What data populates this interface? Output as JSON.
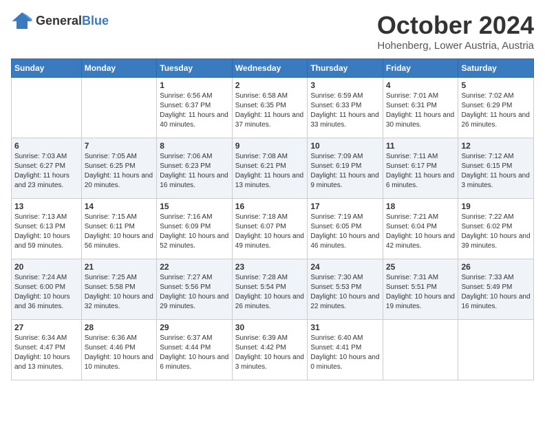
{
  "header": {
    "logo_general": "General",
    "logo_blue": "Blue",
    "month": "October 2024",
    "location": "Hohenberg, Lower Austria, Austria"
  },
  "days_of_week": [
    "Sunday",
    "Monday",
    "Tuesday",
    "Wednesday",
    "Thursday",
    "Friday",
    "Saturday"
  ],
  "weeks": [
    [
      {
        "day": "",
        "info": ""
      },
      {
        "day": "",
        "info": ""
      },
      {
        "day": "1",
        "info": "Sunrise: 6:56 AM\nSunset: 6:37 PM\nDaylight: 11 hours and 40 minutes."
      },
      {
        "day": "2",
        "info": "Sunrise: 6:58 AM\nSunset: 6:35 PM\nDaylight: 11 hours and 37 minutes."
      },
      {
        "day": "3",
        "info": "Sunrise: 6:59 AM\nSunset: 6:33 PM\nDaylight: 11 hours and 33 minutes."
      },
      {
        "day": "4",
        "info": "Sunrise: 7:01 AM\nSunset: 6:31 PM\nDaylight: 11 hours and 30 minutes."
      },
      {
        "day": "5",
        "info": "Sunrise: 7:02 AM\nSunset: 6:29 PM\nDaylight: 11 hours and 26 minutes."
      }
    ],
    [
      {
        "day": "6",
        "info": "Sunrise: 7:03 AM\nSunset: 6:27 PM\nDaylight: 11 hours and 23 minutes."
      },
      {
        "day": "7",
        "info": "Sunrise: 7:05 AM\nSunset: 6:25 PM\nDaylight: 11 hours and 20 minutes."
      },
      {
        "day": "8",
        "info": "Sunrise: 7:06 AM\nSunset: 6:23 PM\nDaylight: 11 hours and 16 minutes."
      },
      {
        "day": "9",
        "info": "Sunrise: 7:08 AM\nSunset: 6:21 PM\nDaylight: 11 hours and 13 minutes."
      },
      {
        "day": "10",
        "info": "Sunrise: 7:09 AM\nSunset: 6:19 PM\nDaylight: 11 hours and 9 minutes."
      },
      {
        "day": "11",
        "info": "Sunrise: 7:11 AM\nSunset: 6:17 PM\nDaylight: 11 hours and 6 minutes."
      },
      {
        "day": "12",
        "info": "Sunrise: 7:12 AM\nSunset: 6:15 PM\nDaylight: 11 hours and 3 minutes."
      }
    ],
    [
      {
        "day": "13",
        "info": "Sunrise: 7:13 AM\nSunset: 6:13 PM\nDaylight: 10 hours and 59 minutes."
      },
      {
        "day": "14",
        "info": "Sunrise: 7:15 AM\nSunset: 6:11 PM\nDaylight: 10 hours and 56 minutes."
      },
      {
        "day": "15",
        "info": "Sunrise: 7:16 AM\nSunset: 6:09 PM\nDaylight: 10 hours and 52 minutes."
      },
      {
        "day": "16",
        "info": "Sunrise: 7:18 AM\nSunset: 6:07 PM\nDaylight: 10 hours and 49 minutes."
      },
      {
        "day": "17",
        "info": "Sunrise: 7:19 AM\nSunset: 6:05 PM\nDaylight: 10 hours and 46 minutes."
      },
      {
        "day": "18",
        "info": "Sunrise: 7:21 AM\nSunset: 6:04 PM\nDaylight: 10 hours and 42 minutes."
      },
      {
        "day": "19",
        "info": "Sunrise: 7:22 AM\nSunset: 6:02 PM\nDaylight: 10 hours and 39 minutes."
      }
    ],
    [
      {
        "day": "20",
        "info": "Sunrise: 7:24 AM\nSunset: 6:00 PM\nDaylight: 10 hours and 36 minutes."
      },
      {
        "day": "21",
        "info": "Sunrise: 7:25 AM\nSunset: 5:58 PM\nDaylight: 10 hours and 32 minutes."
      },
      {
        "day": "22",
        "info": "Sunrise: 7:27 AM\nSunset: 5:56 PM\nDaylight: 10 hours and 29 minutes."
      },
      {
        "day": "23",
        "info": "Sunrise: 7:28 AM\nSunset: 5:54 PM\nDaylight: 10 hours and 26 minutes."
      },
      {
        "day": "24",
        "info": "Sunrise: 7:30 AM\nSunset: 5:53 PM\nDaylight: 10 hours and 22 minutes."
      },
      {
        "day": "25",
        "info": "Sunrise: 7:31 AM\nSunset: 5:51 PM\nDaylight: 10 hours and 19 minutes."
      },
      {
        "day": "26",
        "info": "Sunrise: 7:33 AM\nSunset: 5:49 PM\nDaylight: 10 hours and 16 minutes."
      }
    ],
    [
      {
        "day": "27",
        "info": "Sunrise: 6:34 AM\nSunset: 4:47 PM\nDaylight: 10 hours and 13 minutes."
      },
      {
        "day": "28",
        "info": "Sunrise: 6:36 AM\nSunset: 4:46 PM\nDaylight: 10 hours and 10 minutes."
      },
      {
        "day": "29",
        "info": "Sunrise: 6:37 AM\nSunset: 4:44 PM\nDaylight: 10 hours and 6 minutes."
      },
      {
        "day": "30",
        "info": "Sunrise: 6:39 AM\nSunset: 4:42 PM\nDaylight: 10 hours and 3 minutes."
      },
      {
        "day": "31",
        "info": "Sunrise: 6:40 AM\nSunset: 4:41 PM\nDaylight: 10 hours and 0 minutes."
      },
      {
        "day": "",
        "info": ""
      },
      {
        "day": "",
        "info": ""
      }
    ]
  ]
}
